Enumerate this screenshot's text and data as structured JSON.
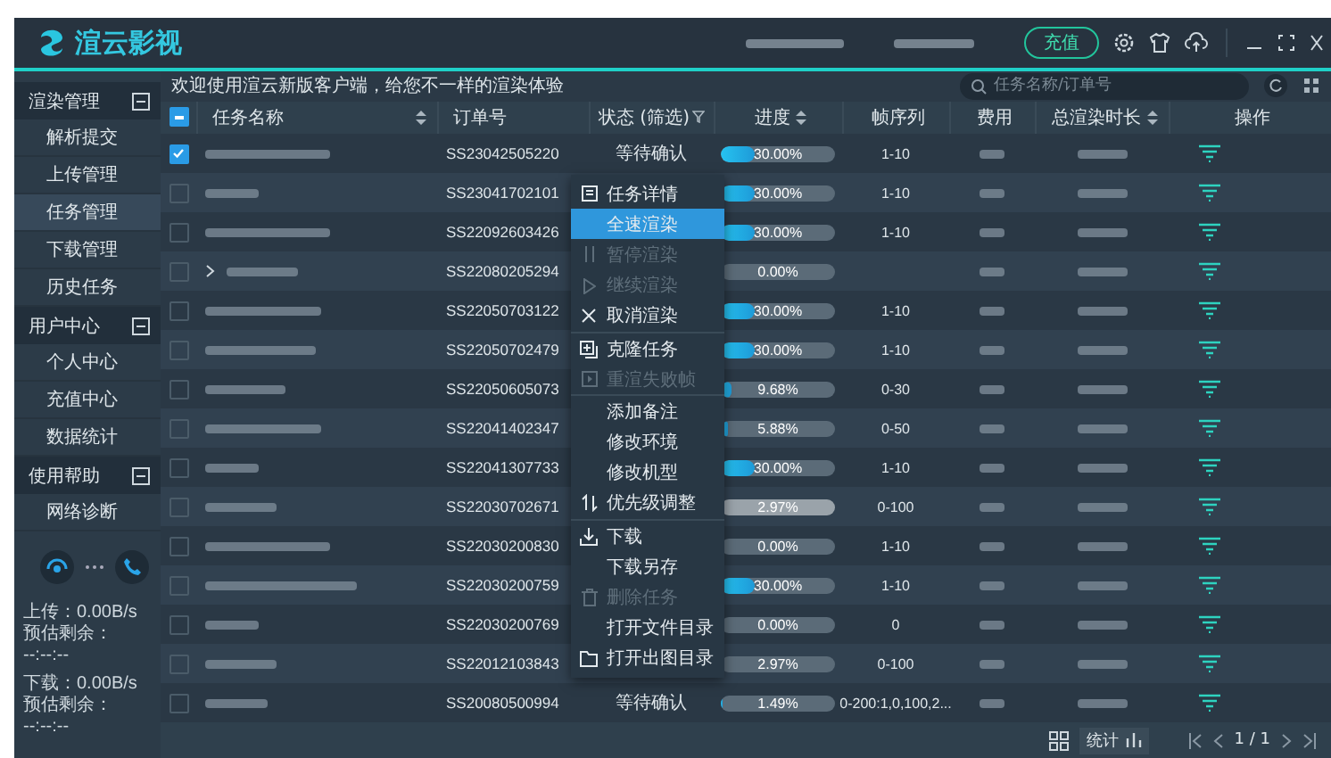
{
  "app": {
    "logo_text": "渲云影视",
    "topup_button": "充值"
  },
  "sidebar": {
    "groups": [
      {
        "label": "渲染管理",
        "expanded": true,
        "items": [
          {
            "label": "解析提交",
            "selected": false
          },
          {
            "label": "上传管理",
            "selected": false
          },
          {
            "label": "任务管理",
            "selected": true
          },
          {
            "label": "下载管理",
            "selected": false
          },
          {
            "label": "历史任务",
            "selected": false
          }
        ]
      },
      {
        "label": "用户中心",
        "expanded": true,
        "items": [
          {
            "label": "个人中心",
            "selected": false
          },
          {
            "label": "充值中心",
            "selected": false
          },
          {
            "label": "数据统计",
            "selected": false
          }
        ]
      },
      {
        "label": "使用帮助",
        "expanded": true,
        "items": [
          {
            "label": "网络诊断",
            "selected": false
          }
        ]
      }
    ],
    "transfer": [
      {
        "speed": "上传：0.00B/s",
        "remaining_label": "预估剩余：",
        "remaining": "--:--:--"
      },
      {
        "speed": "下载：0.00B/s",
        "remaining_label": "预估剩余：",
        "remaining": "--:--:--"
      }
    ]
  },
  "welcome": "欢迎使用渲云新版客户端，给您不一样的渲染体验",
  "search": {
    "placeholder": "任务名称/订单号"
  },
  "table": {
    "select_all_indeterminate": true,
    "columns": [
      {
        "label": "任务名称",
        "sortable": true,
        "filterable": false
      },
      {
        "label": "订单号",
        "sortable": false,
        "filterable": false
      },
      {
        "label": "状态 (筛选)",
        "sortable": false,
        "filterable": true
      },
      {
        "label": "进度",
        "sortable": true,
        "filterable": false
      },
      {
        "label": "帧序列",
        "sortable": false,
        "filterable": false
      },
      {
        "label": "费用",
        "sortable": false,
        "filterable": false
      },
      {
        "label": "总渲染时长",
        "sortable": true,
        "filterable": false
      },
      {
        "label": "操作",
        "sortable": false,
        "filterable": false
      }
    ],
    "rows": [
      {
        "order": "SS23042505220",
        "status": "等待确认",
        "progress": "30.00%",
        "level": 0.3,
        "frames": "1-10",
        "checked": true,
        "expandable": false,
        "paused": false
      },
      {
        "order": "SS23041702101",
        "progress": "30.00%",
        "level": 0.3,
        "frames": "1-10",
        "checked": false,
        "expandable": false,
        "paused": false
      },
      {
        "order": "SS22092603426",
        "progress": "30.00%",
        "level": 0.3,
        "frames": "1-10",
        "checked": false,
        "expandable": false,
        "paused": false
      },
      {
        "order": "SS22080205294",
        "progress": "0.00%",
        "level": 0,
        "checked": false,
        "expandable": true,
        "paused": false
      },
      {
        "order": "SS22050703122",
        "progress": "30.00%",
        "level": 0.3,
        "frames": "1-10",
        "checked": false,
        "expandable": false,
        "paused": false
      },
      {
        "order": "SS22050702479",
        "progress": "30.00%",
        "level": 0.3,
        "frames": "1-10",
        "checked": false,
        "expandable": false,
        "paused": false
      },
      {
        "order": "SS22050605073",
        "progress": "9.68%",
        "level": 0.0968,
        "frames": "0-30",
        "checked": false,
        "expandable": false,
        "paused": false
      },
      {
        "order": "SS22041402347",
        "progress": "5.88%",
        "level": 0.0588,
        "frames": "0-50",
        "checked": false,
        "expandable": false,
        "paused": false
      },
      {
        "order": "SS22041307733",
        "progress": "30.00%",
        "level": 0.3,
        "frames": "1-10",
        "checked": false,
        "expandable": false,
        "paused": false
      },
      {
        "order": "SS22030702671",
        "progress": "2.97%",
        "level": 0.0297,
        "frames": "0-100",
        "checked": false,
        "expandable": false,
        "paused": true
      },
      {
        "order": "SS22030200830",
        "progress": "0.00%",
        "level": 0,
        "frames": "1-10",
        "checked": false,
        "expandable": false,
        "paused": false
      },
      {
        "order": "SS22030200759",
        "progress": "30.00%",
        "level": 0.3,
        "frames": "1-10",
        "checked": false,
        "expandable": false,
        "paused": false
      },
      {
        "order": "SS22030200769",
        "progress": "0.00%",
        "level": 0,
        "frames": "0",
        "checked": false,
        "expandable": false,
        "paused": false
      },
      {
        "order": "SS22012103843",
        "progress": "2.97%",
        "level": 0.0297,
        "frames": "0-100",
        "checked": false,
        "expandable": false,
        "paused": false
      },
      {
        "order": "SS20080500994",
        "status": "等待确认",
        "progress": "1.49%",
        "level": 0.0149,
        "frames": "0-200:1,0,100,2...",
        "checked": false,
        "expandable": false,
        "paused": false
      }
    ]
  },
  "context_menu": [
    {
      "label": "任务详情",
      "kind": "details",
      "disabled": false,
      "selected": false,
      "divider_after": false
    },
    {
      "label": "全速渲染",
      "kind": "plain",
      "disabled": false,
      "selected": true,
      "divider_after": false
    },
    {
      "label": "暂停渲染",
      "kind": "pause",
      "disabled": true,
      "selected": false,
      "divider_after": false
    },
    {
      "label": "继续渲染",
      "kind": "play",
      "disabled": true,
      "selected": false,
      "divider_after": false
    },
    {
      "label": "取消渲染",
      "kind": "cancel",
      "disabled": false,
      "selected": false,
      "divider_after": true
    },
    {
      "label": "克隆任务",
      "kind": "clone",
      "disabled": false,
      "selected": false,
      "divider_after": false
    },
    {
      "label": "重渲失败帧",
      "kind": "rerender",
      "disabled": true,
      "selected": false,
      "divider_after": true
    },
    {
      "label": "添加备注",
      "kind": "plain",
      "disabled": false,
      "selected": false,
      "divider_after": false
    },
    {
      "label": "修改环境",
      "kind": "plain",
      "disabled": false,
      "selected": false,
      "divider_after": false
    },
    {
      "label": "修改机型",
      "kind": "plain",
      "disabled": false,
      "selected": false,
      "divider_after": false
    },
    {
      "label": "优先级调整",
      "kind": "priority",
      "disabled": false,
      "selected": false,
      "divider_after": true
    },
    {
      "label": "下载",
      "kind": "download",
      "disabled": false,
      "selected": false,
      "divider_after": false
    },
    {
      "label": "下载另存",
      "kind": "plain",
      "disabled": false,
      "selected": false,
      "divider_after": false
    },
    {
      "label": "删除任务",
      "kind": "delete",
      "disabled": true,
      "selected": false,
      "divider_after": false
    },
    {
      "label": "打开文件目录",
      "kind": "plain",
      "disabled": false,
      "selected": false,
      "divider_after": false
    },
    {
      "label": "打开出图目录",
      "kind": "folder",
      "disabled": false,
      "selected": false,
      "divider_after": false
    }
  ],
  "footer": {
    "stats_button": "统计",
    "page": "1 / 1"
  }
}
